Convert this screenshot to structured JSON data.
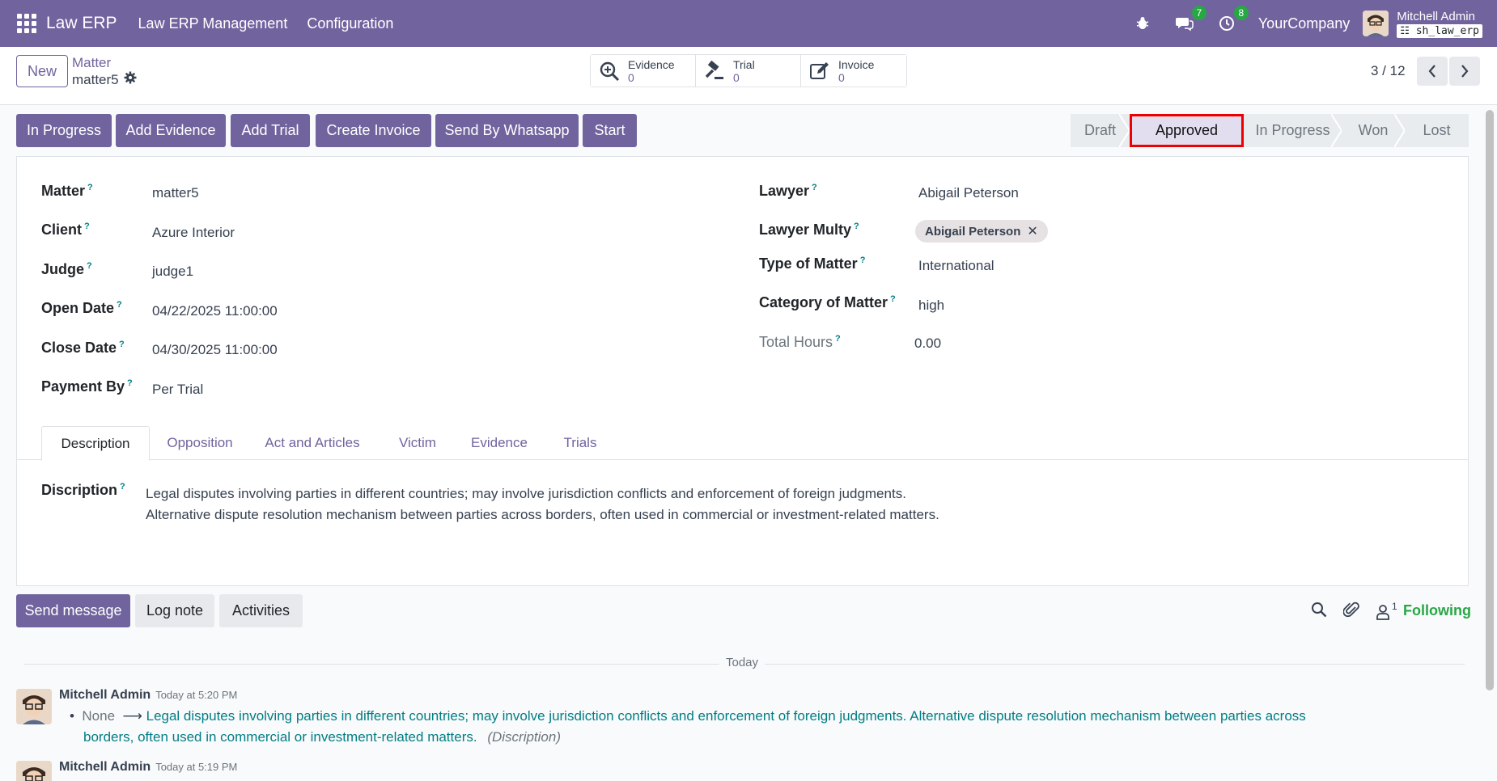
{
  "navbar": {
    "brand": "Law ERP",
    "menu": [
      "Law ERP Management",
      "Configuration"
    ],
    "chat_count": "7",
    "activity_count": "8",
    "company": "YourCompany",
    "user": "Mitchell Admin",
    "db": "sh_law_erp"
  },
  "control": {
    "new_label": "New",
    "breadcrumb_parent": "Matter",
    "breadcrumb_current": "matter5",
    "smart_buttons": [
      {
        "label": "Evidence",
        "value": "0"
      },
      {
        "label": "Trial",
        "value": "0"
      },
      {
        "label": "Invoice",
        "value": "0"
      }
    ],
    "pager": "3 / 12"
  },
  "actions": [
    "In Progress",
    "Add Evidence",
    "Add Trial",
    "Create Invoice",
    "Send By Whatsapp",
    "Start"
  ],
  "stages": [
    "Draft",
    "Approved",
    "In Progress",
    "Won",
    "Lost"
  ],
  "active_stage": "Approved",
  "fields_left": [
    {
      "label": "Matter",
      "value": "matter5"
    },
    {
      "label": "Client",
      "value": "Azure Interior"
    },
    {
      "label": "Judge",
      "value": "judge1"
    },
    {
      "label": "Open Date",
      "value": "04/22/2025 11:00:00"
    },
    {
      "label": "Close Date",
      "value": "04/30/2025 11:00:00"
    },
    {
      "label": "Payment By",
      "value": "Per Trial"
    }
  ],
  "fields_right": {
    "lawyer_label": "Lawyer",
    "lawyer_value": "Abigail Peterson",
    "lawyer_multy_label": "Lawyer Multy",
    "lawyer_multy_tag": "Abigail Peterson",
    "type_label": "Type of Matter",
    "type_value": "International",
    "category_label": "Category of Matter",
    "category_value": "high",
    "hours_label": "Total Hours",
    "hours_value": "0.00"
  },
  "tabs": [
    "Description",
    "Opposition",
    "Act and Articles",
    "Victim",
    "Evidence",
    "Trials"
  ],
  "description": {
    "label": "Discription",
    "line1": "Legal disputes involving parties in different countries; may involve jurisdiction conflicts and enforcement of foreign judgments.",
    "line2": "Alternative dispute resolution mechanism between parties across borders, often used in commercial or investment-related matters."
  },
  "chatter": {
    "send_message": "Send message",
    "log_note": "Log note",
    "activities": "Activities",
    "follower_count": "1",
    "following": "Following",
    "today": "Today",
    "messages": [
      {
        "author": "Mitchell Admin",
        "time": "Today at 5:20 PM",
        "old": "None",
        "new_line1": "Legal disputes involving parties in different countries; may involve jurisdiction conflicts and enforcement of foreign judgments. Alternative dispute resolution mechanism between parties across",
        "new_line2": "borders, often used in commercial or investment-related matters.",
        "field": "(Discription)"
      },
      {
        "author": "Mitchell Admin",
        "time": "Today at 5:19 PM"
      }
    ]
  },
  "colors": {
    "brand": "#71639e",
    "accent_link": "#017e84",
    "following": "#28a745",
    "highlight": "#ee0000"
  }
}
